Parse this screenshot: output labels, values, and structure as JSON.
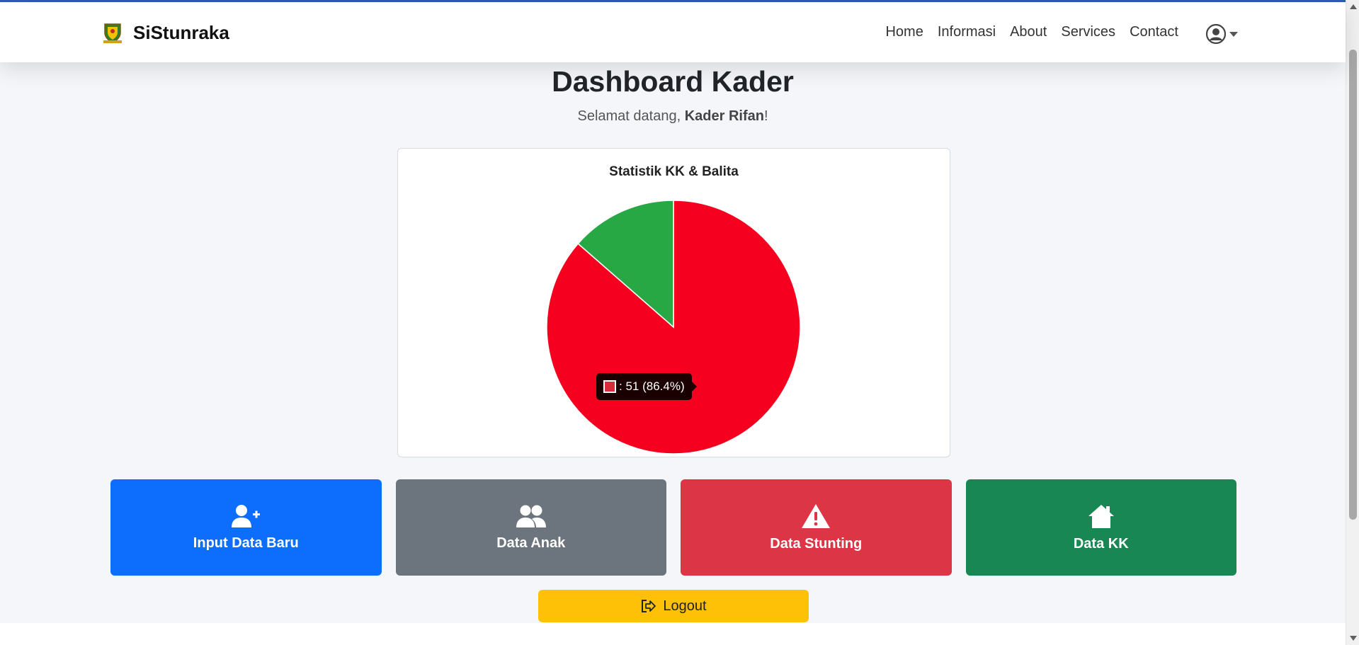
{
  "app": {
    "name": "SiStunraka"
  },
  "nav": {
    "links": [
      "Home",
      "Informasi",
      "About",
      "Services",
      "Contact"
    ],
    "user_icon": "user-circle-icon"
  },
  "page": {
    "title": "Dashboard Kader",
    "welcome_prefix": "Selamat datang, ",
    "user_name": "Kader Rifan",
    "welcome_suffix": "!"
  },
  "chart_data": {
    "type": "pie",
    "title": "Statistik KK & Balita",
    "values": [
      51,
      8
    ],
    "colors": [
      "#f5001f",
      "#28a745"
    ],
    "tooltip": {
      "text": ": 51 (86.4%)"
    }
  },
  "tiles": [
    {
      "label": "Input Data Baru",
      "icon": "user-plus-icon",
      "color": "#0d6efd"
    },
    {
      "label": "Data Anak",
      "icon": "users-icon",
      "color": "#6c757d"
    },
    {
      "label": "Data Stunting",
      "icon": "warning-icon",
      "color": "#dc3545"
    },
    {
      "label": "Data KK",
      "icon": "home-icon",
      "color": "#198754"
    }
  ],
  "logout": {
    "label": "Logout",
    "icon": "logout-icon"
  }
}
